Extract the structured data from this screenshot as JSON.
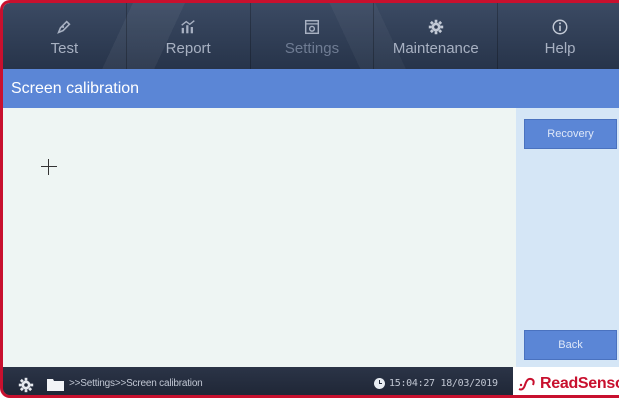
{
  "nav": {
    "tabs": [
      {
        "label": "Test",
        "icon": "pen-icon"
      },
      {
        "label": "Report",
        "icon": "chart-icon"
      },
      {
        "label": "Settings",
        "icon": "settings-box-icon",
        "active": true
      },
      {
        "label": "Maintenance",
        "icon": "gear-icon"
      },
      {
        "label": "Help",
        "icon": "info-icon"
      }
    ]
  },
  "header": {
    "title": "Screen calibration"
  },
  "side": {
    "recovery_label": "Recovery",
    "back_label": "Back"
  },
  "status": {
    "path": ">>Settings>>Screen calibration",
    "datetime": "15:04:27 18/03/2019"
  },
  "brand": {
    "name": "ReadSensor"
  },
  "colors": {
    "accent": "#5b86d6",
    "nav_bg": "#2f3b52",
    "frame": "#c8102e",
    "canvas": "#eef5f3",
    "side_panel": "#d5e6f6"
  }
}
